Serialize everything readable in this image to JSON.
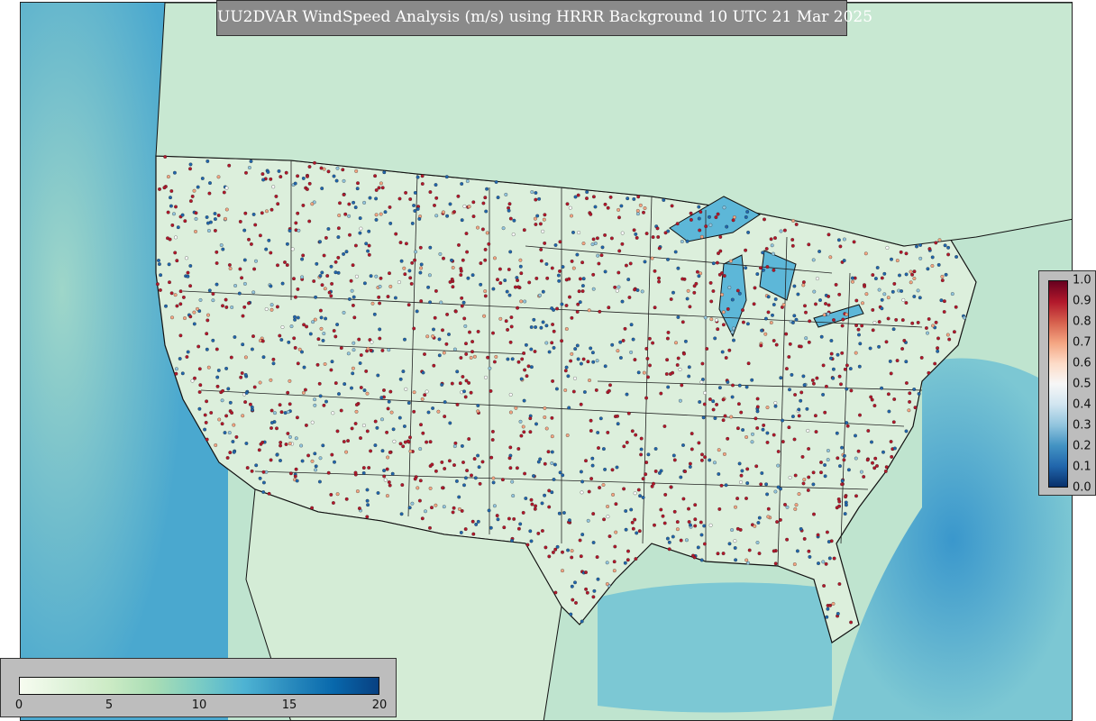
{
  "title": "UU2DVAR WindSpeed Analysis (m/s) using HRRR Background 10 UTC 21 Mar 2025",
  "windspeed_colorbar": {
    "ticks": [
      "0",
      "5",
      "10",
      "15",
      "20"
    ],
    "min": 0,
    "max": 20,
    "colors": [
      "#f7fcf0",
      "#e0f3db",
      "#ccebc5",
      "#a8ddb5",
      "#7bccc4",
      "#4eb3d3",
      "#2b8cbe",
      "#0868ac",
      "#084081"
    ]
  },
  "ratio_colorbar": {
    "ticks": [
      "1.0",
      "0.9",
      "0.8",
      "0.7",
      "0.6",
      "0.5",
      "0.4",
      "0.3",
      "0.2",
      "0.1",
      "0.0"
    ],
    "colors": [
      "#08306b",
      "#2166ac",
      "#4393c3",
      "#92c5de",
      "#d1e5f0",
      "#f7f7f7",
      "#fddbc7",
      "#f4a582",
      "#d6604d",
      "#b2182b",
      "#67001f"
    ]
  },
  "colors": {
    "ocean": "#5fb8d6",
    "land": "#d8eedb",
    "border": "#111111",
    "obs_red": "#b2182b",
    "obs_blue": "#2166ac"
  }
}
